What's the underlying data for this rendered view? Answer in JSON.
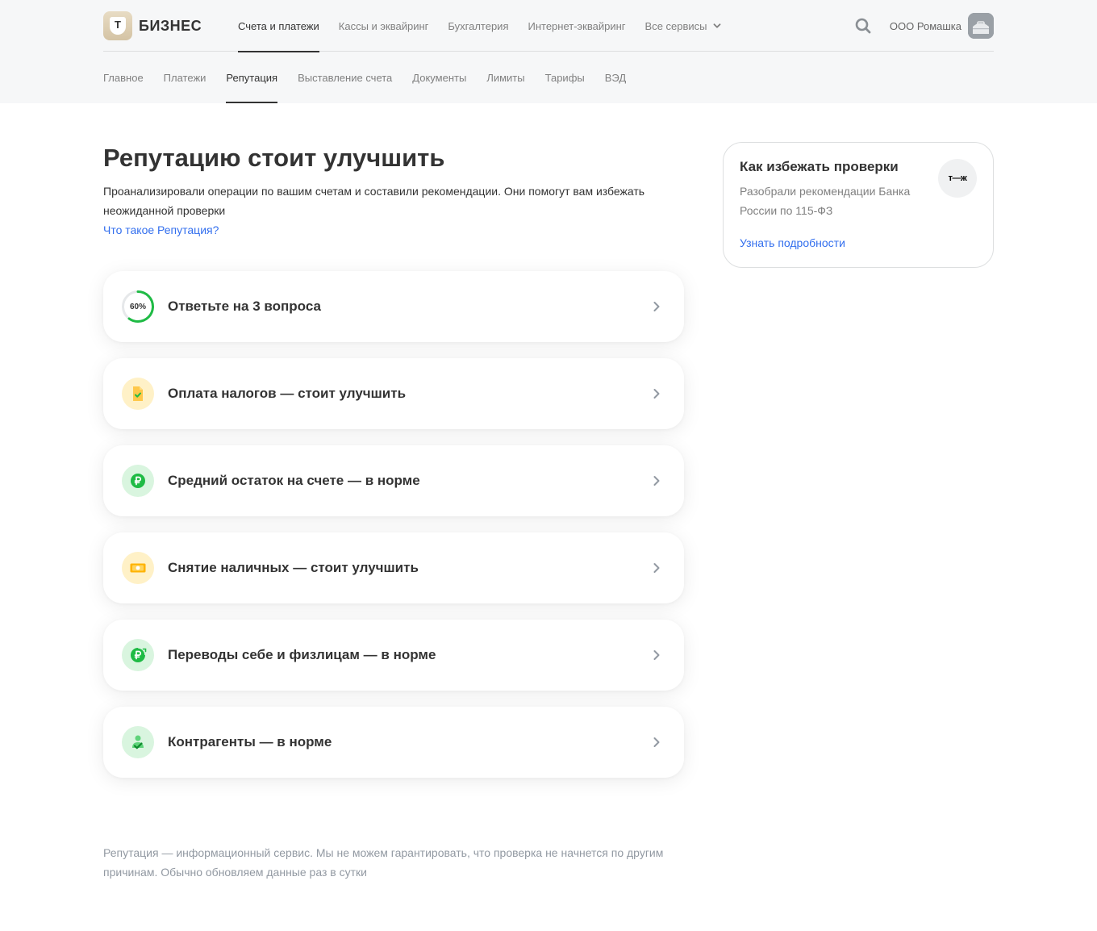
{
  "header": {
    "logo_letter": "Т",
    "logo_text": "БИЗНЕС",
    "main_nav": [
      "Счета и платежи",
      "Кассы и эквайринг",
      "Бухгалтерия",
      "Интернет-эквайринг",
      "Все сервисы"
    ],
    "company": "ООО Ромашка"
  },
  "subnav": [
    "Главное",
    "Платежи",
    "Репутация",
    "Выставление счета",
    "Документы",
    "Лимиты",
    "Тарифы",
    "ВЭД"
  ],
  "main": {
    "title": "Репутацию стоит улучшить",
    "description": "Проанализировали операции по вашим счетам и составили рекомендации. Они помогут вам избежать неожиданной проверки",
    "link": "Что такое Репутация?",
    "cards": [
      {
        "label": "Ответьте на 3 вопроса",
        "icon": "progress-ring-icon",
        "progress_text": "60%",
        "progress": 0.6
      },
      {
        "label": "Оплата налогов — стоит улучшить",
        "icon": "tax-document-icon"
      },
      {
        "label": "Средний остаток на счете — в норме",
        "icon": "ruble-coin-icon"
      },
      {
        "label": "Снятие наличных — стоит улучшить",
        "icon": "cash-banknote-icon"
      },
      {
        "label": "Переводы себе и физлицам — в норме",
        "icon": "ruble-transfer-icon"
      },
      {
        "label": "Контрагенты — в норме",
        "icon": "counterparty-check-icon"
      }
    ],
    "disclaimer": "Репутация — информационный сервис. Мы не можем гарантировать, что проверка не начнется по другим причинам. Обычно обновляем данные раз в сутки"
  },
  "side_card": {
    "title": "Как избежать проверки",
    "text": "Разобрали рекомендации Банка России по 115-ФЗ",
    "link": "Узнать подробности",
    "logo_text": "т—ж"
  },
  "colors": {
    "accent_link": "#336fee",
    "ok_green": "#1fbb45",
    "warn_yellow": "#ffc84a",
    "text_primary": "#333333",
    "text_secondary": "#808080"
  }
}
